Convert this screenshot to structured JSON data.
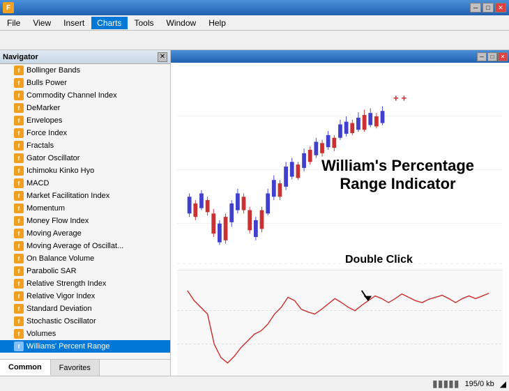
{
  "window": {
    "title": "",
    "app_icon": "F",
    "controls": {
      "minimize": "─",
      "maximize": "□",
      "close": "✕"
    }
  },
  "menu": {
    "items": [
      "File",
      "View",
      "Insert",
      "Charts",
      "Tools",
      "Window",
      "Help"
    ],
    "active": "Charts"
  },
  "navigator": {
    "title": "Navigator",
    "close_label": "✕",
    "indicators": [
      "Bollinger Bands",
      "Bulls Power",
      "Commodity Channel Index",
      "DeMarker",
      "Envelopes",
      "Force Index",
      "Fractals",
      "Gator Oscillator",
      "Ichimoku Kinko Hyo",
      "MACD",
      "Market Facilitation Index",
      "Momentum",
      "Money Flow Index",
      "Moving Average",
      "Moving Average of Oscillat...",
      "On Balance Volume",
      "Parabolic SAR",
      "Relative Strength Index",
      "Relative Vigor Index",
      "Standard Deviation",
      "Stochastic Oscillator",
      "Volumes",
      "Williams' Percent Range"
    ],
    "selected_index": 22,
    "tabs": [
      "Common",
      "Favorites"
    ],
    "active_tab": "Common"
  },
  "chart": {
    "annotation_line1": "William's Percentage",
    "annotation_line2": "Range Indicator",
    "double_click": "Double Click"
  },
  "status_bar": {
    "bars_icon": "▮▮▮▮▮",
    "info": "195/0 kb",
    "resize_icon": "◢"
  }
}
